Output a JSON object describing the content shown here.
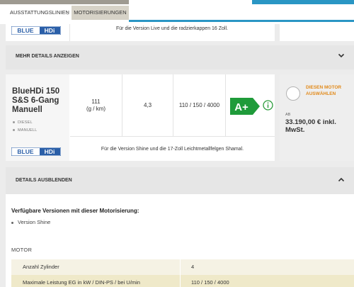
{
  "breadcrumb": {
    "step1": "AUSSTATTUNGSLINIEN",
    "step2": "MOTORISIERUNGEN"
  },
  "prev_card": {
    "logo": "BLUE HDi",
    "note": "Für die Version Live und die radzierkappen 16 Zoll."
  },
  "more_details_label": "MEHR DETAILS ANZEIGEN",
  "engine": {
    "name": "BlueHDi 150 S&S 6-Gang Manuell",
    "tags": [
      "DIESEL",
      "MANUELL"
    ],
    "co2": "111\n(g / km)",
    "consumption": "4,3",
    "power": "110 / 150 / 4000",
    "energy_class": "A+",
    "logo": "BLUE HDi",
    "note": "Für die Version Shine und die 17-Zoll Leichtmetallfelgen Shamal."
  },
  "select": {
    "label": "DIESEN MOTOR AUSWÄHLEN",
    "from": "AB",
    "price": "33.190,00 € inkl. MwSt."
  },
  "hide_details_label": "DETAILS AUSBLENDEN",
  "details": {
    "versions_title": "Verfügbare Versionen mit dieser Motorisierung:",
    "versions": [
      "Version Shine"
    ],
    "section": "MOTOR",
    "rows": [
      {
        "key": "Anzahl Zylinder",
        "value": "4"
      },
      {
        "key": "Maximale Leistung EG in kW / DIN-PS / bei U/min",
        "value": "110 / 150 / 4000"
      }
    ]
  },
  "colors": {
    "accent_blue": "#2a96c4",
    "orange": "#e28a1a",
    "energy_green": "#1f9b3a"
  }
}
